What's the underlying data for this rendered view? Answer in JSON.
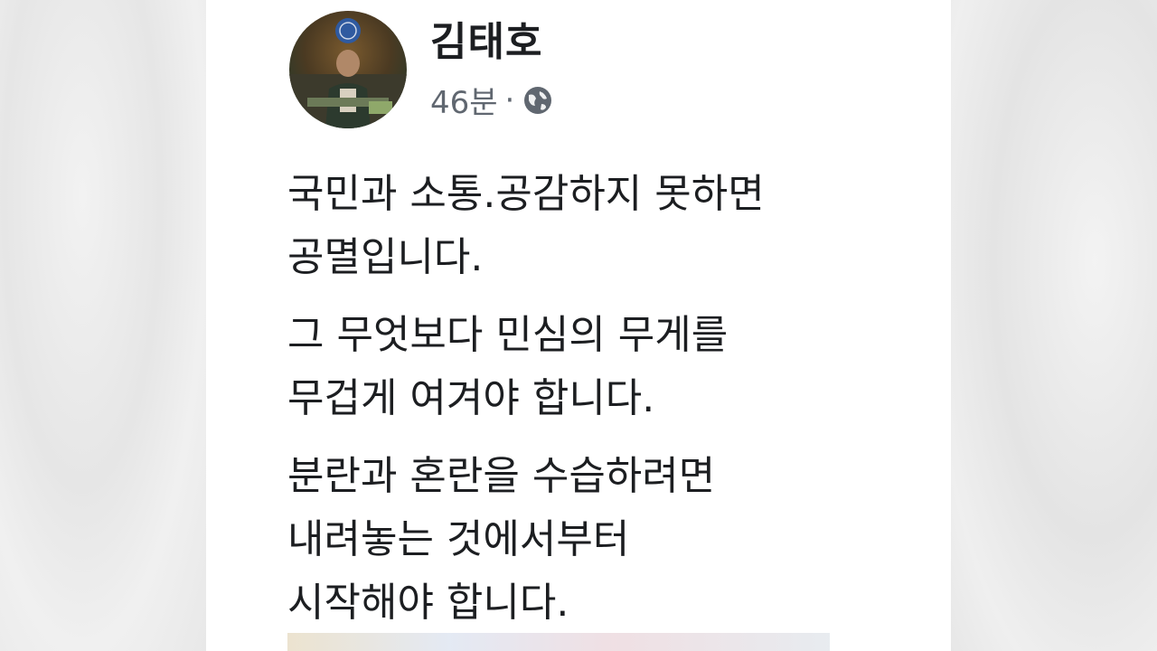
{
  "post": {
    "author": "김태호",
    "time": "46분",
    "separator": "·",
    "privacy_icon": "globe-icon",
    "avatar_icon": "profile-photo",
    "paragraphs": [
      {
        "lines": [
          "국민과 소통.공감하지 못하면",
          "공멸입니다."
        ]
      },
      {
        "lines": [
          "그 무엇보다 민심의 무게를",
          "무겁게 여겨야 합니다."
        ]
      },
      {
        "lines": [
          "분란과 혼란을 수습하려면",
          "내려놓는 것에서부터",
          "시작해야 합니다."
        ]
      }
    ]
  }
}
